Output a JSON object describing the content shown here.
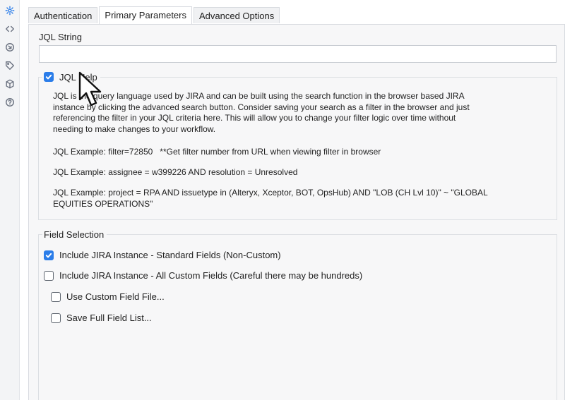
{
  "tabs": [
    {
      "label": "Authentication",
      "selected": false
    },
    {
      "label": "Primary Parameters",
      "selected": true
    },
    {
      "label": "Advanced Options",
      "selected": false
    }
  ],
  "rail_icons": [
    "gear-icon",
    "code-icon",
    "arrow-circle-icon",
    "tag-icon",
    "cube-icon",
    "help-icon"
  ],
  "jql": {
    "label": "JQL String",
    "value": ""
  },
  "help": {
    "checkbox_label": "JQL Help",
    "checked": true,
    "paragraph_lines": [
      "JQL is the query language used by JIRA and can be built using the search function in the browser based JIRA",
      "instance by clicking the advanced search button. Consider saving your search as a filter in the browser and just",
      "referencing the filter in your JQL criteria here. This will allow you to change your filter logic over time without",
      "needing to make changes to your workflow."
    ],
    "example1": "JQL Example: filter=72850   **Get filter number from URL when viewing filter in browser",
    "example2": "JQL Example: assignee = w399226 AND resolution = Unresolved",
    "example3_lines": [
      "JQL Example: project = RPA AND issuetype in (Alteryx, Xceptor, BOT, OpsHub) AND \"LOB (CH Lvl 10)\" ~ \"GLOBAL",
      "EQUITIES OPERATIONS\""
    ]
  },
  "field_selection": {
    "title": "Field Selection",
    "options": [
      {
        "label": "Include JIRA Instance - Standard Fields (Non-Custom)",
        "checked": true
      },
      {
        "label": "Include JIRA Instance - All Custom Fields (Careful there may be hundreds)",
        "checked": false
      },
      {
        "label": "Use Custom Field File...",
        "checked": false
      },
      {
        "label": "Save Full Field List...",
        "checked": false
      }
    ]
  },
  "colors": {
    "accent": "#2b7de9",
    "panel_bg": "#f7f7f8",
    "border": "#d8dbe0"
  }
}
